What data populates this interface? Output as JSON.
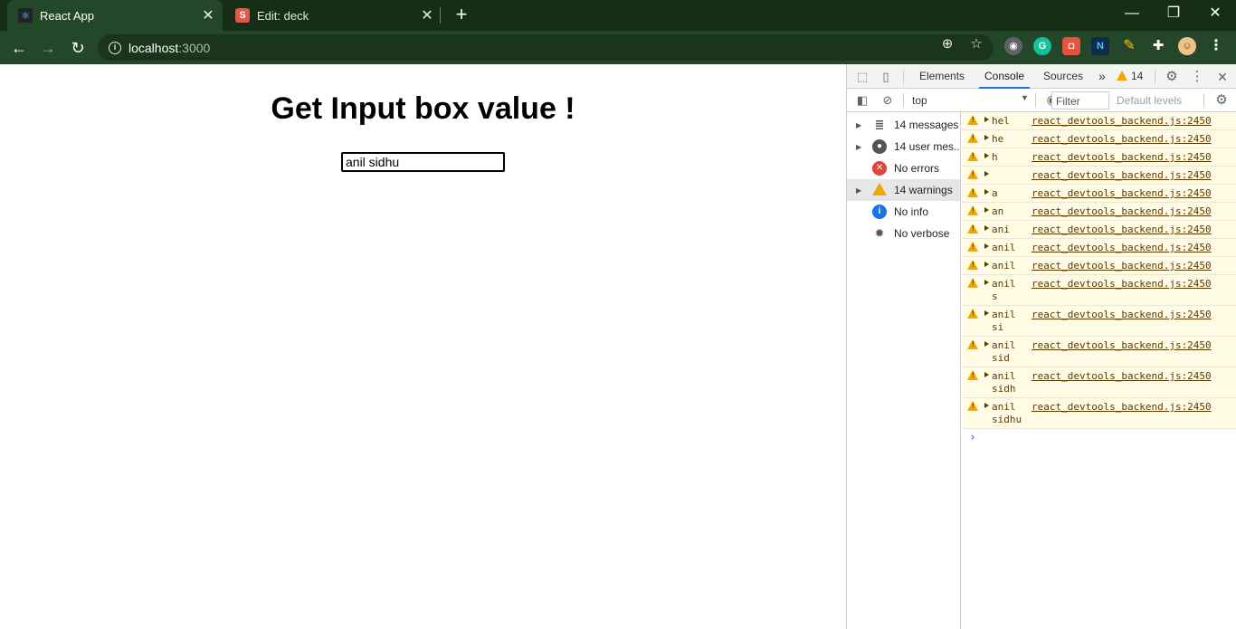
{
  "browser": {
    "tabs": [
      {
        "title": "React App",
        "favicon": "react-icon",
        "active": true
      },
      {
        "title": "Edit: deck",
        "favicon": "s-icon",
        "active": false
      }
    ],
    "url_host": "localhost",
    "url_port": ":3000",
    "window_controls": [
      "minimize",
      "restore",
      "close"
    ]
  },
  "page": {
    "heading": "Get Input box value !",
    "input_value": "anil sidhu"
  },
  "devtools": {
    "tabs": [
      "Elements",
      "Console",
      "Sources"
    ],
    "active_tab": "Console",
    "more_tabs": "»",
    "warning_count": "14",
    "context": "top",
    "filter_placeholder": "Filter",
    "levels": "Default levels",
    "sidebar": [
      {
        "label": "14 messages",
        "icon": "list-icon",
        "expandable": true
      },
      {
        "label": "14 user mes...",
        "icon": "user-icon",
        "expandable": true
      },
      {
        "label": "No errors",
        "icon": "error-icon",
        "expandable": false
      },
      {
        "label": "14 warnings",
        "icon": "warning-icon",
        "expandable": true,
        "selected": true
      },
      {
        "label": "No info",
        "icon": "info-icon",
        "expandable": false
      },
      {
        "label": "No verbose",
        "icon": "bug-icon",
        "expandable": false
      }
    ],
    "messages": [
      {
        "text": "hel",
        "source": "react_devtools_backend.js:2450"
      },
      {
        "text": "he",
        "source": "react_devtools_backend.js:2450"
      },
      {
        "text": "h",
        "source": "react_devtools_backend.js:2450"
      },
      {
        "text": "",
        "source": "react_devtools_backend.js:2450"
      },
      {
        "text": "a",
        "source": "react_devtools_backend.js:2450"
      },
      {
        "text": "an",
        "source": "react_devtools_backend.js:2450"
      },
      {
        "text": "ani",
        "source": "react_devtools_backend.js:2450"
      },
      {
        "text": "anil",
        "source": "react_devtools_backend.js:2450"
      },
      {
        "text": "anil",
        "source": "react_devtools_backend.js:2450"
      },
      {
        "text": "anil\ns",
        "source": "react_devtools_backend.js:2450"
      },
      {
        "text": "anil\nsi",
        "source": "react_devtools_backend.js:2450"
      },
      {
        "text": "anil\nsid",
        "source": "react_devtools_backend.js:2450"
      },
      {
        "text": "anil\nsidh",
        "source": "react_devtools_backend.js:2450"
      },
      {
        "text": "anil\nsidhu",
        "source": "react_devtools_backend.js:2450"
      }
    ],
    "prompt": "›"
  },
  "colors": {
    "chrome_frame": "#1f3b1f",
    "toolbar": "#24472a",
    "warning_bg": "#fffbe5",
    "warning_icon": "#f2a600",
    "accent": "#1a73e8"
  }
}
